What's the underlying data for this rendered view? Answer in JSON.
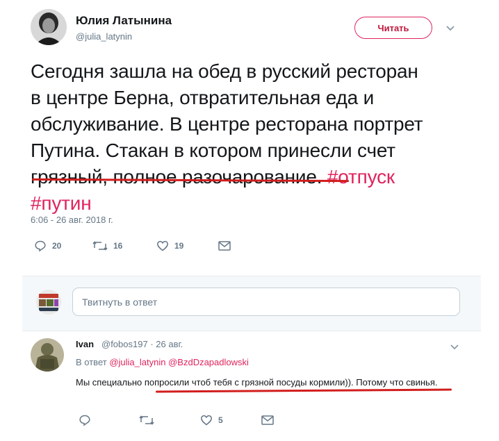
{
  "tweet": {
    "author_name": "Юлия Латынина",
    "author_handle": "@julia_latynin",
    "follow_label": "Читать",
    "text_lines": [
      "Сегодня зашла на обед в русский ресторан",
      "в центре Берна, отвратительная еда и",
      "обслуживание. В центре ресторана портрет",
      "Путина. Стакан в котором принесли счет",
      "грязный, полное разочарование."
    ],
    "hashtags": [
      "#отпуск",
      "#путин"
    ],
    "timestamp": "6:06 - 26 авг. 2018 г.",
    "actions": {
      "reply_count": "20",
      "retweet_count": "16",
      "like_count": "19"
    }
  },
  "reply_box": {
    "placeholder": "Твитнуть в ответ"
  },
  "comment": {
    "author_name": "Ivan",
    "author_handle": "@fobos197",
    "date": "· 26 авг.",
    "reply_to_prefix": "В ответ",
    "reply_to_users": [
      "@julia_latynin",
      "@BzdDzapadlowski"
    ],
    "text": "Мы специально попросили чтоб тебя с грязной посуды кормили)). Потому что свинья.",
    "actions": {
      "reply_count": "",
      "retweet_count": "",
      "like_count": "5"
    }
  },
  "icons": {
    "reply": "reply-icon",
    "retweet": "retweet-icon",
    "like": "heart-icon",
    "dm": "envelope-icon",
    "menu": "chevron-down-icon"
  },
  "colors": {
    "accent": "#e0245e",
    "secondary_text": "#657786",
    "annotation_underline": "#d21d1d"
  }
}
